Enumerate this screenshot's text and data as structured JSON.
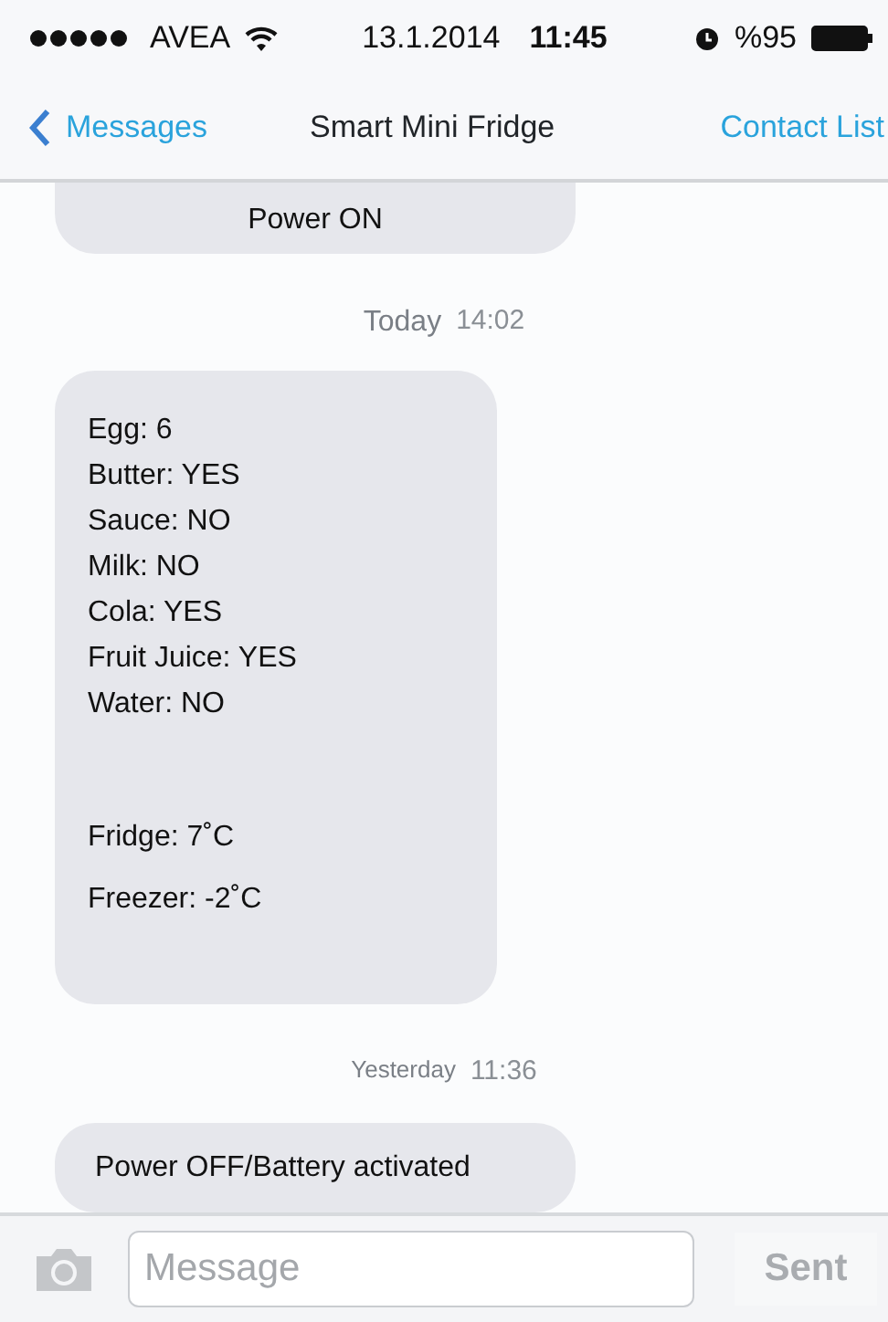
{
  "status_bar": {
    "carrier": "AVEA",
    "date": "13.1.2014",
    "time": "11:45",
    "battery": "%95"
  },
  "nav": {
    "back": "Messages",
    "title": "Smart Mini Fridge",
    "action": "Contact List"
  },
  "messages": [
    {
      "kind": "bubble",
      "lines": [
        {
          "kind": "text",
          "text": "Power ON"
        }
      ]
    },
    {
      "kind": "timestamp",
      "day": "Today",
      "time": "14:02"
    },
    {
      "kind": "bubble",
      "lines": [
        {
          "kind": "stock",
          "text": "Egg: 6"
        },
        {
          "kind": "stock",
          "text": "Butter:  YES"
        },
        {
          "kind": "stock",
          "text": "Sauce:  NO"
        },
        {
          "kind": "stock",
          "text": "Milk:  NO"
        },
        {
          "kind": "stock",
          "text": "Cola:  YES"
        },
        {
          "kind": "stock",
          "text": "Fruit Juice:  YES"
        },
        {
          "kind": "stock",
          "text": "Water:  NO"
        },
        {
          "kind": "temperature",
          "text": "Fridge: 7˚C"
        },
        {
          "kind": "temperature",
          "text": "Freezer: -2˚C"
        }
      ]
    },
    {
      "kind": "timestamp",
      "day": "Yesterday",
      "time": "11:36"
    },
    {
      "kind": "bubble",
      "lines": [
        {
          "kind": "text",
          "text": "Power OFF/Battery activated"
        }
      ]
    }
  ],
  "composer": {
    "placeholder": "Message",
    "send": "Sent",
    "send_disabled": true
  }
}
